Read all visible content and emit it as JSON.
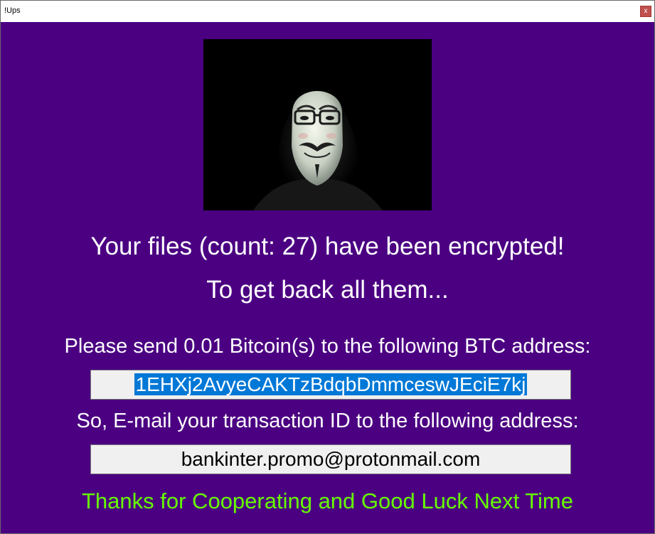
{
  "window": {
    "title": "!Ups",
    "close_label": "x"
  },
  "main": {
    "heading": "Your files (count: 27) have been encrypted!",
    "subheading": "To get back all them...",
    "send_instruction": "Please send 0.01 Bitcoin(s) to the following BTC address:",
    "btc_address": "1EHXj2AvyeCAKTzBdqbDmmceswJEciE7kj",
    "email_instruction": "So, E-mail your transaction ID to the following address:",
    "email_address": "bankinter.promo@protonmail.com",
    "closing": "Thanks for Cooperating and Good Luck Next Time"
  },
  "colors": {
    "background": "#4b0082",
    "text": "#ffffff",
    "closing_text": "#66ff00",
    "selection": "#0078d7",
    "close_button": "#c0504d"
  },
  "image": {
    "subject": "hooded-figure-with-guy-fawkes-mask"
  }
}
